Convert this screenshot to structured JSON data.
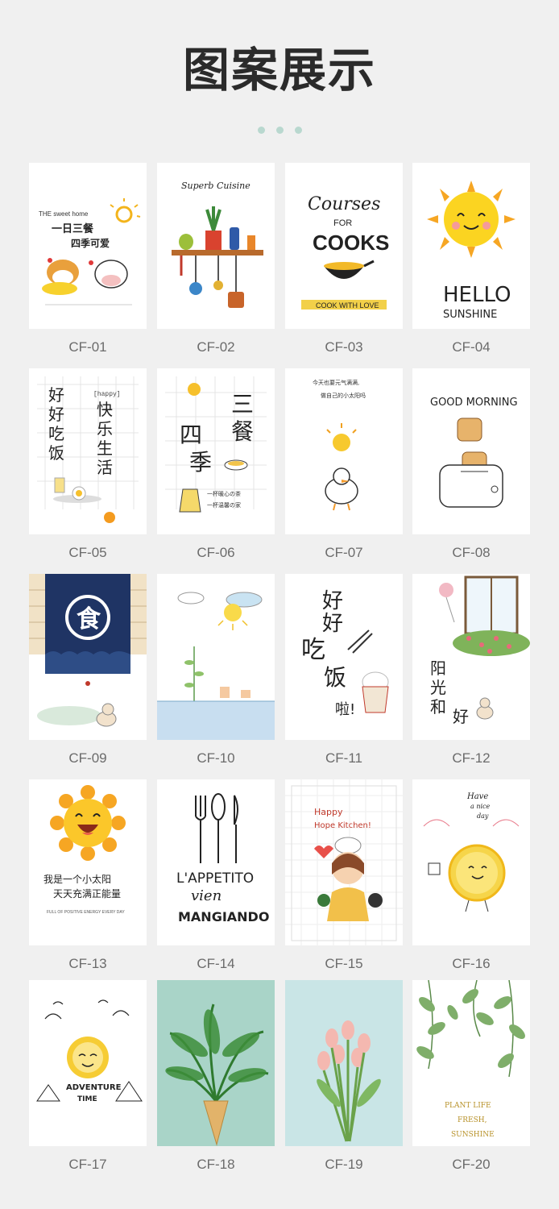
{
  "page": {
    "title": "图案展示"
  },
  "dots": [
    "#b9d8cf",
    "#b9d8cf",
    "#b9d8cf"
  ],
  "cards": [
    {
      "code": "CF-01",
      "icon": "sweet-home-animals-icon",
      "texts": [
        "THE sweet home",
        "一日三餐",
        "四季可爱"
      ]
    },
    {
      "code": "CF-02",
      "icon": "kitchen-shelf-utensils-icon",
      "texts": [
        "Superb Cuisine"
      ]
    },
    {
      "code": "CF-03",
      "icon": "cooking-pot-icon",
      "texts": [
        "Courses",
        "FOR",
        "COOKS",
        "COOK WITH LOVE"
      ]
    },
    {
      "code": "CF-04",
      "icon": "smiling-sun-icon",
      "texts": [
        "HELLO",
        "SUNSHINE"
      ]
    },
    {
      "code": "CF-05",
      "icon": "breakfast-grid-icon",
      "texts": [
        "好",
        "好",
        "吃",
        "饭",
        "[happy]",
        "快",
        "乐",
        "生",
        "活"
      ]
    },
    {
      "code": "CF-06",
      "icon": "tea-pot-grid-icon",
      "texts": [
        "三",
        "餐",
        "四",
        "季",
        "一杯暖心の茶",
        "一杯温馨の家"
      ]
    },
    {
      "code": "CF-07",
      "icon": "sun-and-duck-icon",
      "texts": [
        "今天也要元气满满,",
        "做自己的小太阳吗"
      ]
    },
    {
      "code": "CF-08",
      "icon": "toaster-icon",
      "texts": [
        "GOOD MORNING"
      ]
    },
    {
      "code": "CF-09",
      "icon": "food-banner-cat-icon",
      "texts": [
        "食"
      ]
    },
    {
      "code": "CF-10",
      "icon": "sun-clouds-plants-icon",
      "texts": []
    },
    {
      "code": "CF-11",
      "icon": "rice-bowl-chopsticks-icon",
      "texts": [
        "好",
        "好",
        "吃",
        "饭",
        "啦!"
      ]
    },
    {
      "code": "CF-12",
      "icon": "window-flowers-cat-icon",
      "texts": [
        "阳",
        "光",
        "和",
        "好"
      ]
    },
    {
      "code": "CF-13",
      "icon": "laughing-sun-icon",
      "texts": [
        "我是一个小太阳",
        "天天充满正能量",
        "FULL OF POSITIVE ENERGY EVERY DAY"
      ]
    },
    {
      "code": "CF-14",
      "icon": "cutlery-icon",
      "texts": [
        "L'APPETITO",
        "vien",
        "MANGIANDO"
      ]
    },
    {
      "code": "CF-15",
      "icon": "chef-girl-icon",
      "texts": [
        "Happy",
        "Hope Kitchen!"
      ]
    },
    {
      "code": "CF-16",
      "icon": "lemon-slice-icon",
      "texts": [
        "Have",
        "a nice",
        "day"
      ]
    },
    {
      "code": "CF-17",
      "icon": "adventure-sun-icon",
      "texts": [
        "ADVENTURE",
        "TIME"
      ]
    },
    {
      "code": "CF-18",
      "icon": "palm-leaf-cone-icon",
      "texts": []
    },
    {
      "code": "CF-19",
      "icon": "pink-tulips-icon",
      "texts": []
    },
    {
      "code": "CF-20",
      "icon": "hanging-leaves-icon",
      "texts": [
        "PLANT LIFE",
        "FRESH,",
        "SUNSHINE"
      ]
    }
  ]
}
